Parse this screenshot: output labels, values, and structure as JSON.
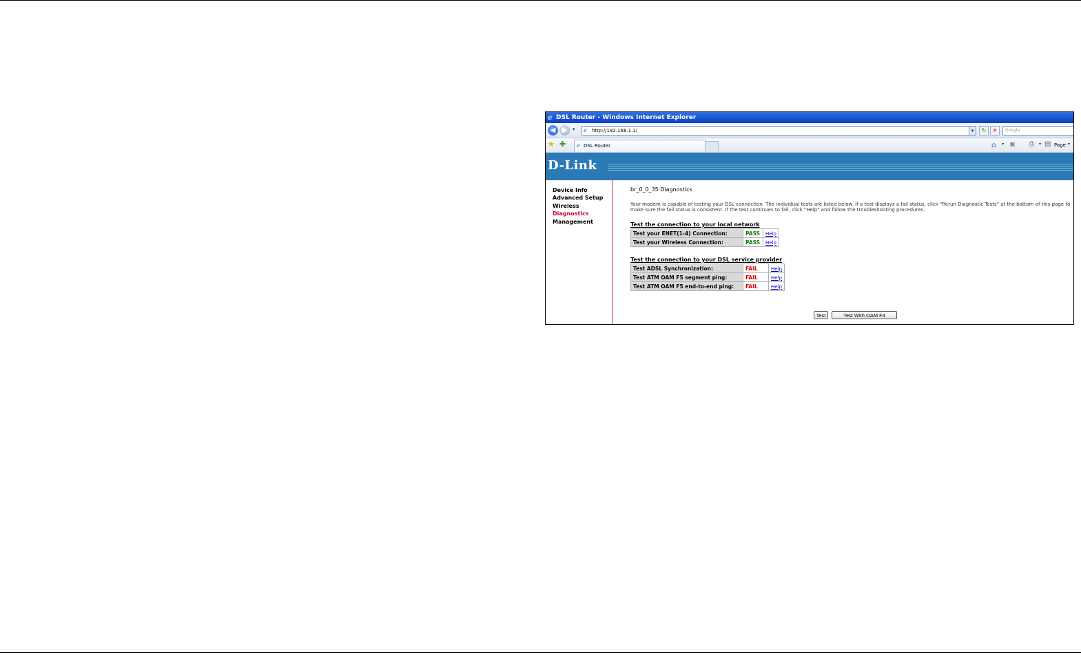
{
  "window": {
    "title": "DSL Router - Windows Internet Explorer"
  },
  "address_bar": {
    "url": "http://192.168.1.1/",
    "search_placeholder": "Google"
  },
  "tabs": [
    {
      "label": "DSL Router"
    }
  ],
  "command_bar": {
    "page_label": "Page"
  },
  "brand": {
    "logo": "D-Link",
    "banner_color": "#2b7ab6"
  },
  "sidebar": {
    "items": [
      {
        "label": "Device Info"
      },
      {
        "label": "Advanced Setup"
      },
      {
        "label": "Wireless"
      },
      {
        "label": "Diagnostics",
        "active": true
      },
      {
        "label": "Management"
      }
    ]
  },
  "main": {
    "title": "br_0_0_35 Diagnostics",
    "intro": "Your modem is capable of testing your DSL connection. The individual tests are listed below. If a test displays a fail status, click \"Rerun Diagnostic Tests\" at the bottom of this page to make sure the fail status is consistent. If the test continues to fail, click \"Help\" and follow the troubleshooting procedures.",
    "local_section": {
      "heading": "Test the connection to your local network",
      "tests": [
        {
          "label": "Test your ENET(1-4) Connection:",
          "status": "PASS",
          "help": "Help"
        },
        {
          "label": "Test your Wireless Connection:",
          "status": "PASS",
          "help": "Help"
        }
      ]
    },
    "provider_section": {
      "heading": "Test the connection to your DSL service provider",
      "tests": [
        {
          "label": "Test ADSL Synchronization:",
          "status": "FAIL",
          "help": "Help"
        },
        {
          "label": "Test ATM OAM F5 segment ping:",
          "status": "FAIL",
          "help": "Help"
        },
        {
          "label": "Test ATM OAM F5 end-to-end ping:",
          "status": "FAIL",
          "help": "Help"
        }
      ]
    },
    "buttons": {
      "test": "Test",
      "test_oam_f4": "Test With OAM F4"
    }
  },
  "colors": {
    "pass": "#0a7a0a",
    "fail": "#e00000",
    "active_nav": "#c80028"
  }
}
